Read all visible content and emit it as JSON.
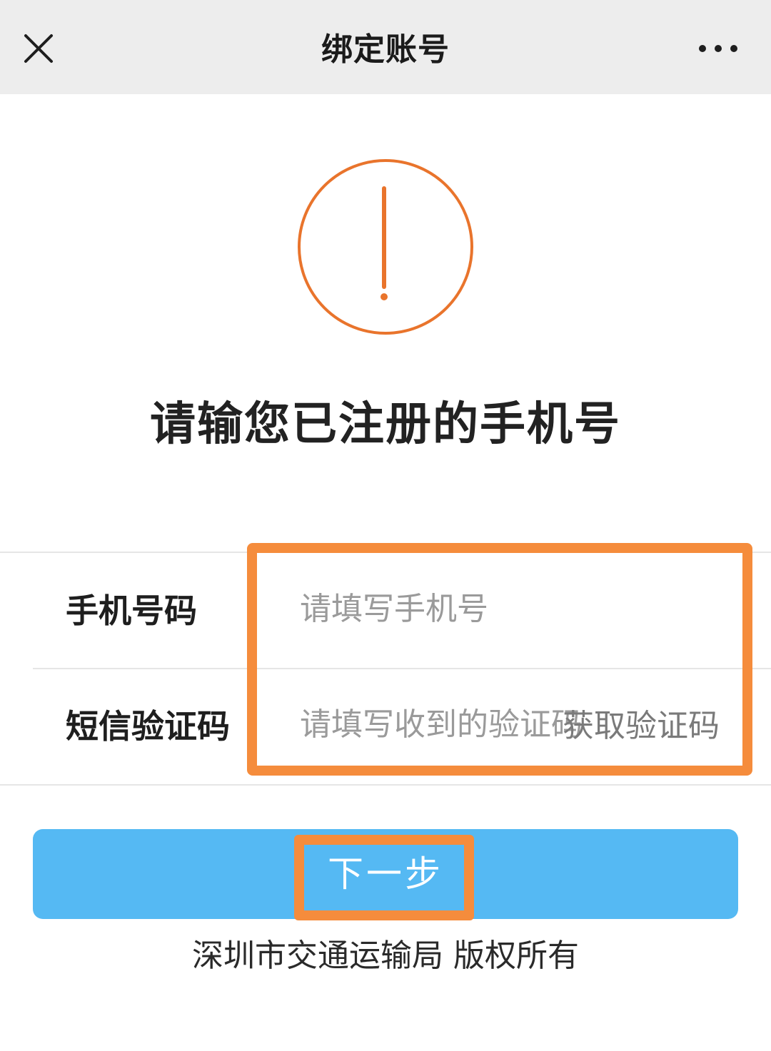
{
  "navbar": {
    "title": "绑定账号",
    "close_icon": "close-icon",
    "more_icon": "more-horizontal-icon"
  },
  "warning": {
    "icon": "exclamation-circle-icon",
    "color": "#e9742c"
  },
  "headline": "请输您已注册的手机号",
  "form": {
    "phone": {
      "label": "手机号码",
      "placeholder": "请填写手机号",
      "value": ""
    },
    "code": {
      "label": "短信验证码",
      "placeholder": "请填写收到的验证码",
      "value": "",
      "get_code_label": "获取验证码"
    }
  },
  "next_button": {
    "label": "下一步",
    "color": "#55b9f3"
  },
  "highlight_color": "#f58c3c",
  "footer": "深圳市交通运输局 版权所有"
}
